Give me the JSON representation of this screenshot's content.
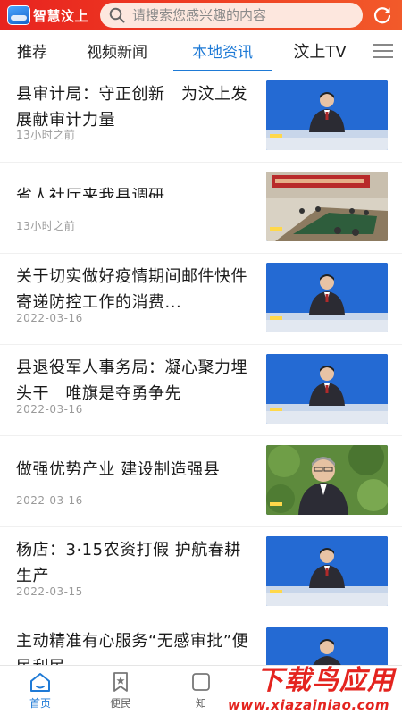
{
  "header": {
    "app_name": "智慧汶上",
    "search_placeholder": "请搜索您感兴趣的内容"
  },
  "tabs": [
    {
      "label": "推荐"
    },
    {
      "label": "视频新闻"
    },
    {
      "label": "本地资讯",
      "active": true
    },
    {
      "label": "汶上TV"
    }
  ],
  "feed": [
    {
      "title": "县审计局：守正创新　为汶上发展献审计力量",
      "meta": "13小时之前",
      "thumb": "anchor"
    },
    {
      "title": "省人社厅来我县调研",
      "meta": "13小时之前",
      "thumb": "meeting"
    },
    {
      "title": "关于切实做好疫情期间邮件快件寄递防控工作的消费...",
      "meta": "2022-03-16",
      "thumb": "anchor"
    },
    {
      "title": "县退役军人事务局：凝心聚力埋头干　唯旗是夺勇争先",
      "meta": "2022-03-16",
      "thumb": "anchor"
    },
    {
      "title": "做强优势产业 建设制造强县",
      "meta": "2022-03-16",
      "thumb": "interview"
    },
    {
      "title": "杨店：3·15农资打假 护航春耕生产",
      "meta": "2022-03-15",
      "thumb": "anchor"
    },
    {
      "title": "主动精准有心服务“无感审批”便民利民",
      "meta": "",
      "thumb": "anchor"
    }
  ],
  "bottom_nav": [
    {
      "label": "首页",
      "icon": "home-icon",
      "active": true
    },
    {
      "label": "便民",
      "icon": "bookmark-icon"
    },
    {
      "label": "知",
      "icon": "info-icon"
    }
  ],
  "watermark": {
    "main": "下载鸟应用",
    "sub": "www.xiazainiao.com"
  },
  "colors": {
    "header_red": "#e8231f",
    "accent_blue": "#1e7ad6",
    "watermark_red": "#e4241f"
  }
}
